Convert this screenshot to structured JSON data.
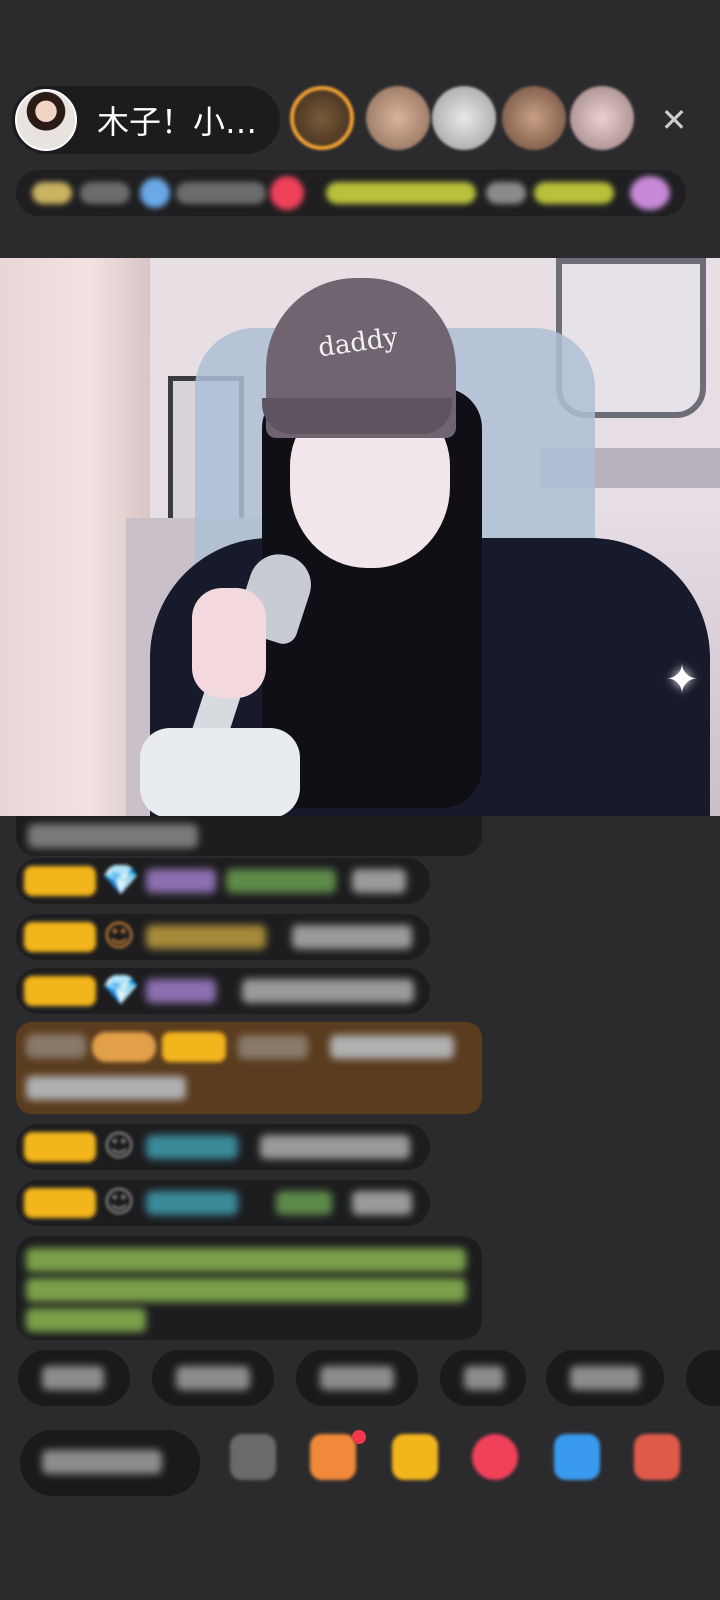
{
  "header": {
    "host_name": "木子！小…",
    "close_icon": "✕"
  },
  "video": {
    "cap_text": "daddy",
    "sparkle_icon": "✦"
  },
  "colors": {
    "background": "#2b2b2d",
    "badge_gold": "#f2b51c",
    "highlight_brown": "#5a3c1f",
    "ticker_gold": "#b8c13a",
    "gem_purple": "#b13ee8",
    "accent_red": "#f2384a"
  },
  "icons": {
    "gem": "💎",
    "face": "☺"
  }
}
